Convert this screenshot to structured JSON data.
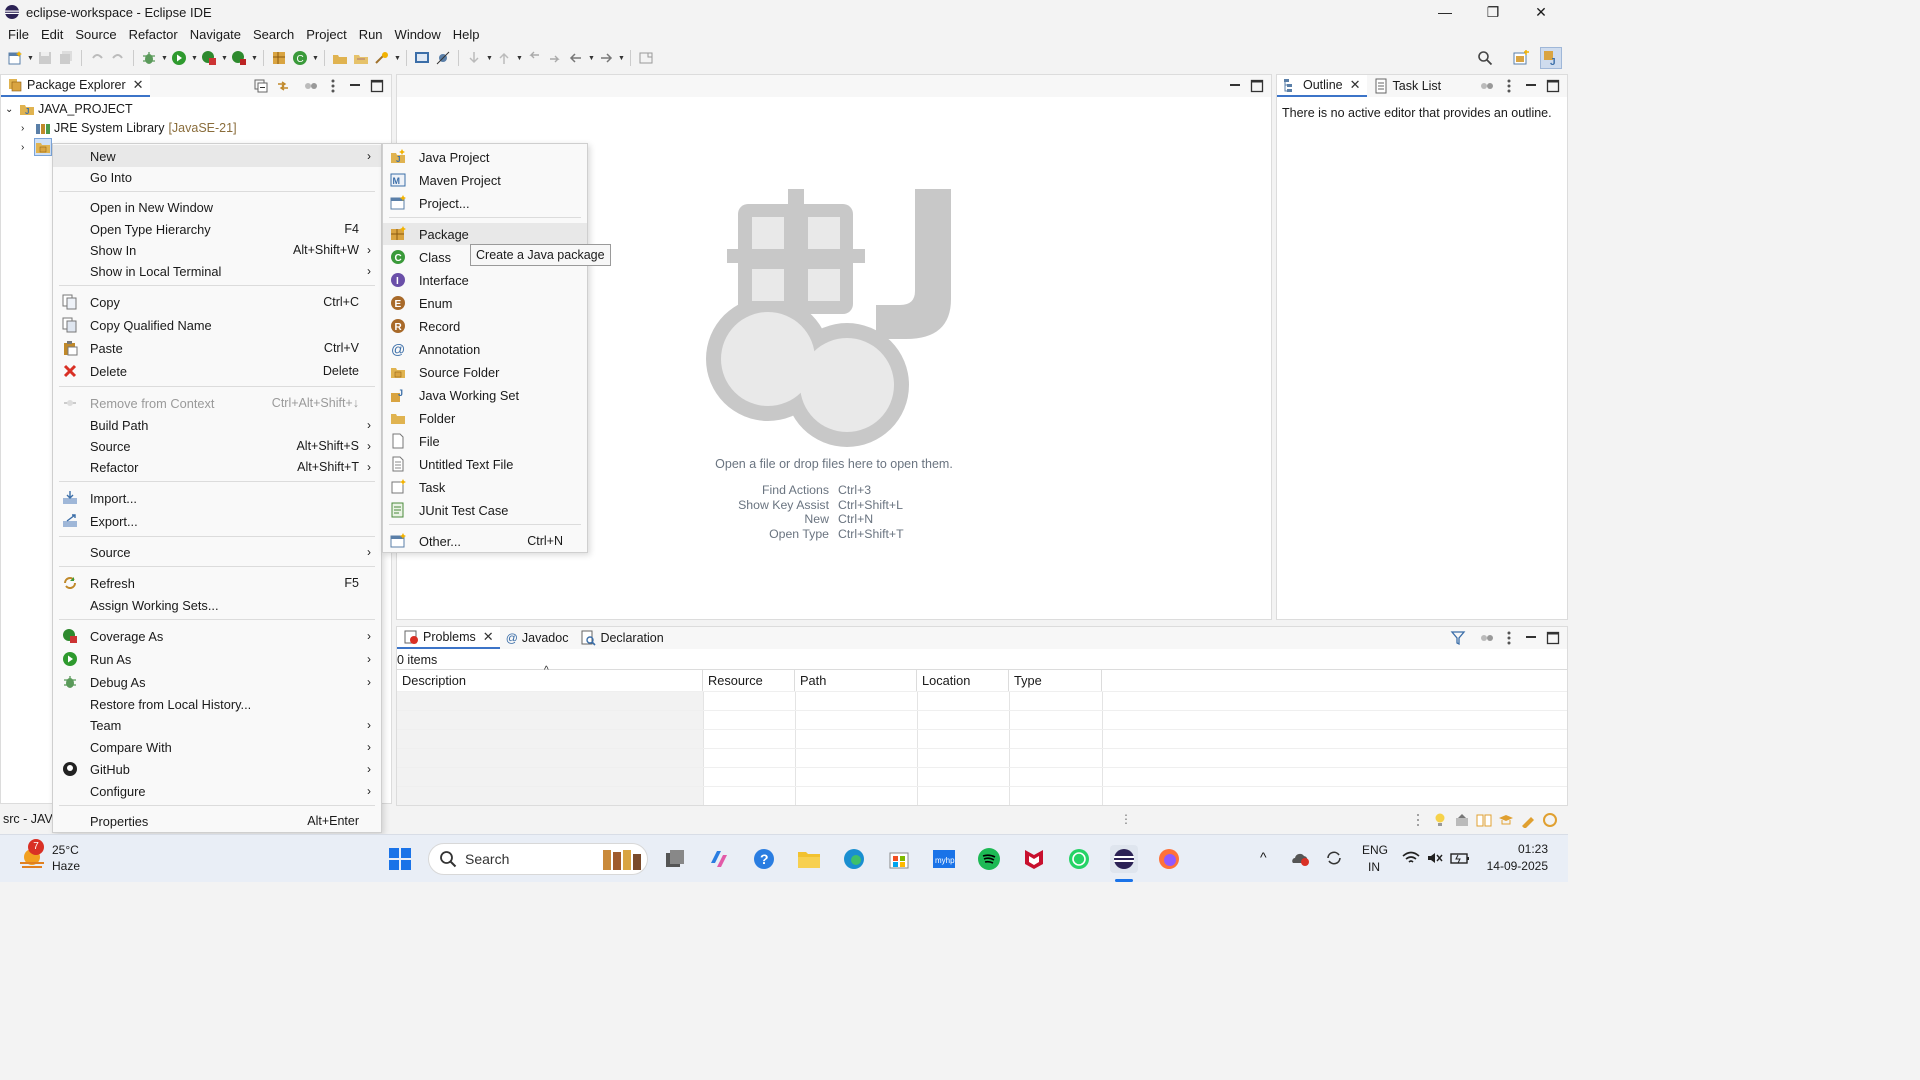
{
  "window": {
    "title": "eclipse-workspace - Eclipse IDE",
    "minimize": "—",
    "restore": "❐",
    "close": "✕"
  },
  "menubar": [
    "File",
    "Edit",
    "Source",
    "Refactor",
    "Navigate",
    "Search",
    "Project",
    "Run",
    "Window",
    "Help"
  ],
  "package_explorer": {
    "tab_label": "Package Explorer",
    "tree": {
      "project": "JAVA_PROJECT",
      "jre": "JRE System Library",
      "jre_version": "[JavaSE-21]"
    },
    "status_text": "src - JAVA"
  },
  "context_menu": {
    "items": [
      {
        "label": "New",
        "accel": "",
        "submenu": true
      },
      {
        "label": "Go Into",
        "accel": ""
      },
      {
        "label": "Open in New Window",
        "accel": ""
      },
      {
        "label": "Open Type Hierarchy",
        "accel": "F4"
      },
      {
        "label": "Show In",
        "accel": "Alt+Shift+W",
        "submenu": true
      },
      {
        "label": "Show in Local Terminal",
        "accel": "",
        "submenu": true
      },
      {
        "label": "Copy",
        "accel": "Ctrl+C"
      },
      {
        "label": "Copy Qualified Name",
        "accel": ""
      },
      {
        "label": "Paste",
        "accel": "Ctrl+V"
      },
      {
        "label": "Delete",
        "accel": "Delete"
      },
      {
        "label": "Remove from Context",
        "accel": "Ctrl+Alt+Shift+↓",
        "disabled": true
      },
      {
        "label": "Build Path",
        "accel": "",
        "submenu": true
      },
      {
        "label": "Source",
        "accel": "Alt+Shift+S",
        "submenu": true
      },
      {
        "label": "Refactor",
        "accel": "Alt+Shift+T",
        "submenu": true
      },
      {
        "label": "Import...",
        "accel": ""
      },
      {
        "label": "Export...",
        "accel": ""
      },
      {
        "label": "Source",
        "accel": "",
        "submenu": true
      },
      {
        "label": "Refresh",
        "accel": "F5"
      },
      {
        "label": "Assign Working Sets...",
        "accel": ""
      },
      {
        "label": "Coverage As",
        "accel": "",
        "submenu": true
      },
      {
        "label": "Run As",
        "accel": "",
        "submenu": true
      },
      {
        "label": "Debug As",
        "accel": "",
        "submenu": true
      },
      {
        "label": "Restore from Local History...",
        "accel": ""
      },
      {
        "label": "Team",
        "accel": "",
        "submenu": true
      },
      {
        "label": "Compare With",
        "accel": "",
        "submenu": true
      },
      {
        "label": "GitHub",
        "accel": "",
        "submenu": true
      },
      {
        "label": "Configure",
        "accel": "",
        "submenu": true
      },
      {
        "label": "Properties",
        "accel": "Alt+Enter"
      }
    ],
    "arrow": "›"
  },
  "new_submenu": {
    "items": [
      {
        "label": "Java Project",
        "accel": ""
      },
      {
        "label": "Maven Project",
        "accel": ""
      },
      {
        "label": "Project...",
        "accel": ""
      },
      {
        "label": "Package",
        "accel": ""
      },
      {
        "label": "Class",
        "accel": ""
      },
      {
        "label": "Interface",
        "accel": ""
      },
      {
        "label": "Enum",
        "accel": ""
      },
      {
        "label": "Record",
        "accel": ""
      },
      {
        "label": "Annotation",
        "accel": ""
      },
      {
        "label": "Source Folder",
        "accel": ""
      },
      {
        "label": "Java Working Set",
        "accel": ""
      },
      {
        "label": "Folder",
        "accel": ""
      },
      {
        "label": "File",
        "accel": ""
      },
      {
        "label": "Untitled Text File",
        "accel": ""
      },
      {
        "label": "Task",
        "accel": ""
      },
      {
        "label": "JUnit Test Case",
        "accel": ""
      },
      {
        "label": "Other...",
        "accel": "Ctrl+N"
      }
    ],
    "tooltip": "Create a Java package"
  },
  "editor": {
    "drop_hint": "Open a file or drop files here to open them.",
    "shortcuts": [
      {
        "name": "Find Actions",
        "key": "Ctrl+3"
      },
      {
        "name": "Show Key Assist",
        "key": "Ctrl+Shift+L"
      },
      {
        "name": "New",
        "key": "Ctrl+N"
      },
      {
        "name": "Open Type",
        "key": "Ctrl+Shift+T"
      }
    ]
  },
  "outline": {
    "tab_outline": "Outline",
    "tab_tasklist": "Task List",
    "message": "There is no active editor that provides an outline."
  },
  "problems": {
    "tabs": [
      "Problems",
      "Javadoc",
      "Declaration"
    ],
    "count": "0 items",
    "columns": [
      "Description",
      "Resource",
      "Path",
      "Location",
      "Type"
    ]
  },
  "taskbar": {
    "weather_temp": "25°C",
    "weather_desc": "Haze",
    "weather_badge": "7",
    "search_placeholder": "Search",
    "lang": "ENG",
    "region": "IN",
    "time": "01:23",
    "date": "14-09-2025"
  },
  "colors": {
    "accent": "#3c74c8",
    "java_green": "#3a9a3a",
    "delete_red": "#d93025"
  }
}
